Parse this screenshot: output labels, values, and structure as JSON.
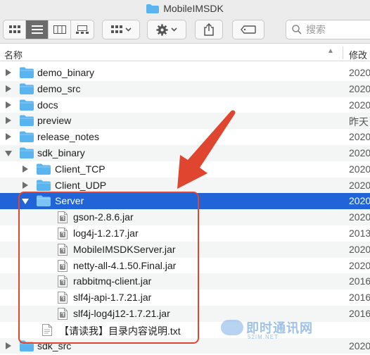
{
  "window": {
    "title": "MobileIMSDK",
    "icon": "folder-icon"
  },
  "toolbar": {
    "view_modes": [
      "icon-view",
      "list-view",
      "column-view",
      "gallery-view"
    ],
    "active_view": "list-view",
    "group_button": "group-icon",
    "action_button": "gear-icon",
    "share_button": "share-icon",
    "tag_button": "tag-icon",
    "search_placeholder": "搜索"
  },
  "columns": {
    "name": "名称",
    "date": "修改"
  },
  "rows": [
    {
      "name": "demo_binary",
      "type": "folder",
      "level": 0,
      "disclosure": "collapsed",
      "date": "2020"
    },
    {
      "name": "demo_src",
      "type": "folder",
      "level": 0,
      "disclosure": "collapsed",
      "date": "2020"
    },
    {
      "name": "docs",
      "type": "folder",
      "level": 0,
      "disclosure": "collapsed",
      "date": "2020"
    },
    {
      "name": "preview",
      "type": "folder",
      "level": 0,
      "disclosure": "collapsed",
      "date": "昨天"
    },
    {
      "name": "release_notes",
      "type": "folder",
      "level": 0,
      "disclosure": "collapsed",
      "date": "2020"
    },
    {
      "name": "sdk_binary",
      "type": "folder",
      "level": 0,
      "disclosure": "expanded",
      "date": "2020"
    },
    {
      "name": "Client_TCP",
      "type": "folder",
      "level": 1,
      "disclosure": "collapsed",
      "date": "2020"
    },
    {
      "name": "Client_UDP",
      "type": "folder",
      "level": 1,
      "disclosure": "collapsed",
      "date": "2020"
    },
    {
      "name": "Server",
      "type": "folder",
      "level": 1,
      "disclosure": "expanded",
      "date": "2020",
      "selected": true
    },
    {
      "name": "gson-2.8.6.jar",
      "type": "jar",
      "level": 2,
      "date": "2020"
    },
    {
      "name": "log4j-1.2.17.jar",
      "type": "jar",
      "level": 2,
      "date": "2013"
    },
    {
      "name": "MobileIMSDKServer.jar",
      "type": "jar",
      "level": 2,
      "date": "2020"
    },
    {
      "name": "netty-all-4.1.50.Final.jar",
      "type": "jar",
      "level": 2,
      "date": "2020"
    },
    {
      "name": "rabbitmq-client.jar",
      "type": "jar",
      "level": 2,
      "date": "2016"
    },
    {
      "name": "slf4j-api-1.7.21.jar",
      "type": "jar",
      "level": 2,
      "date": "2016"
    },
    {
      "name": "slf4j-log4j12-1.7.21.jar",
      "type": "jar",
      "level": 2,
      "date": "2016"
    },
    {
      "name": "【请读我】目录内容说明.txt",
      "type": "txt",
      "level": 1,
      "date": ""
    },
    {
      "name": "sdk_src",
      "type": "folder",
      "level": 0,
      "disclosure": "collapsed",
      "date": "2020"
    }
  ],
  "annotation": {
    "color": "#e0452f",
    "kind": "red-arrow-and-box"
  },
  "watermark": {
    "text": "即时通讯网",
    "sub": "52IM.NET"
  },
  "colors": {
    "selection": "#2164d7",
    "folder": "#5ab4ef",
    "annotation": "#e0452f"
  }
}
